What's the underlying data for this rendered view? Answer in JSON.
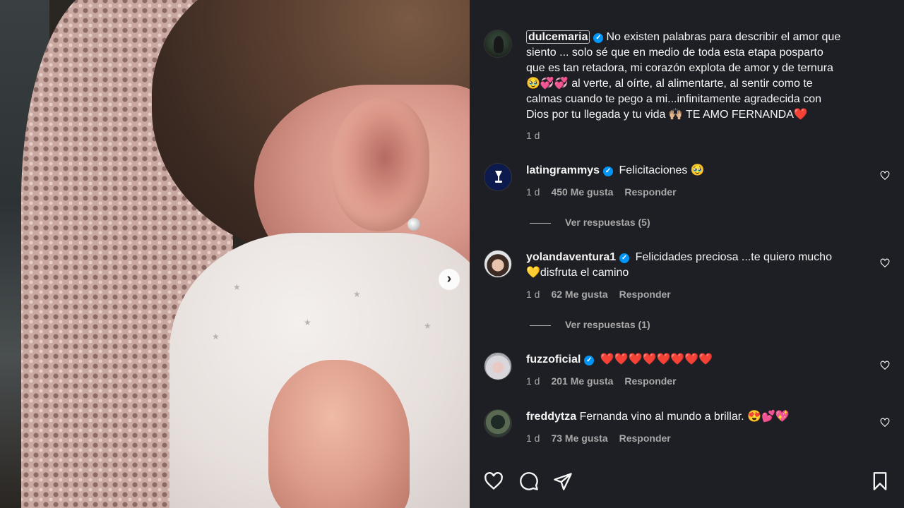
{
  "post": {
    "next_icon": "chevron-right-icon"
  },
  "caption": {
    "username": "dulcemaria",
    "lines": [
      "No existen palabras para describir el amor que",
      "siento ... solo sé que en medio de toda esta etapa posparto",
      "que es tan retadora, mi corazón explota de amor y de ternura",
      "🥹💞💞 al verte, al oírte, al alimentarte, al sentir como te",
      "calmas cuando te pego a mi...infinitamente agradecida con",
      "Dios por tu llegada y tu vida 🙌🏼 TE AMO FERNANDA❤️"
    ],
    "time": "1 d"
  },
  "comments": [
    {
      "username": "latingrammys",
      "verified": true,
      "lines": [
        "Felicitaciones 🥹"
      ],
      "time": "1 d",
      "likes": "450 Me gusta",
      "reply": "Responder",
      "view_replies": "Ver respuestas (5)"
    },
    {
      "username": "yolandaventura1",
      "verified": true,
      "lines": [
        "Felicidades preciosa ...te quiero mucho",
        "💛disfruta el camino"
      ],
      "time": "1 d",
      "likes": "62 Me gusta",
      "reply": "Responder",
      "view_replies": "Ver respuestas (1)"
    },
    {
      "username": "fuzzoficial",
      "verified": true,
      "lines": [
        "❤️❤️❤️❤️❤️❤️❤️❤️"
      ],
      "time": "1 d",
      "likes": "201 Me gusta",
      "reply": "Responder"
    },
    {
      "username": "freddytza",
      "verified": false,
      "lines": [
        "Fernanda vino al mundo a brillar. 😍💕💖"
      ],
      "time": "1 d",
      "likes": "73 Me gusta",
      "reply": "Responder"
    }
  ],
  "actions": {
    "like_icon": "heart-icon",
    "comment_icon": "comment-icon",
    "share_icon": "share-icon",
    "save_icon": "bookmark-icon"
  }
}
